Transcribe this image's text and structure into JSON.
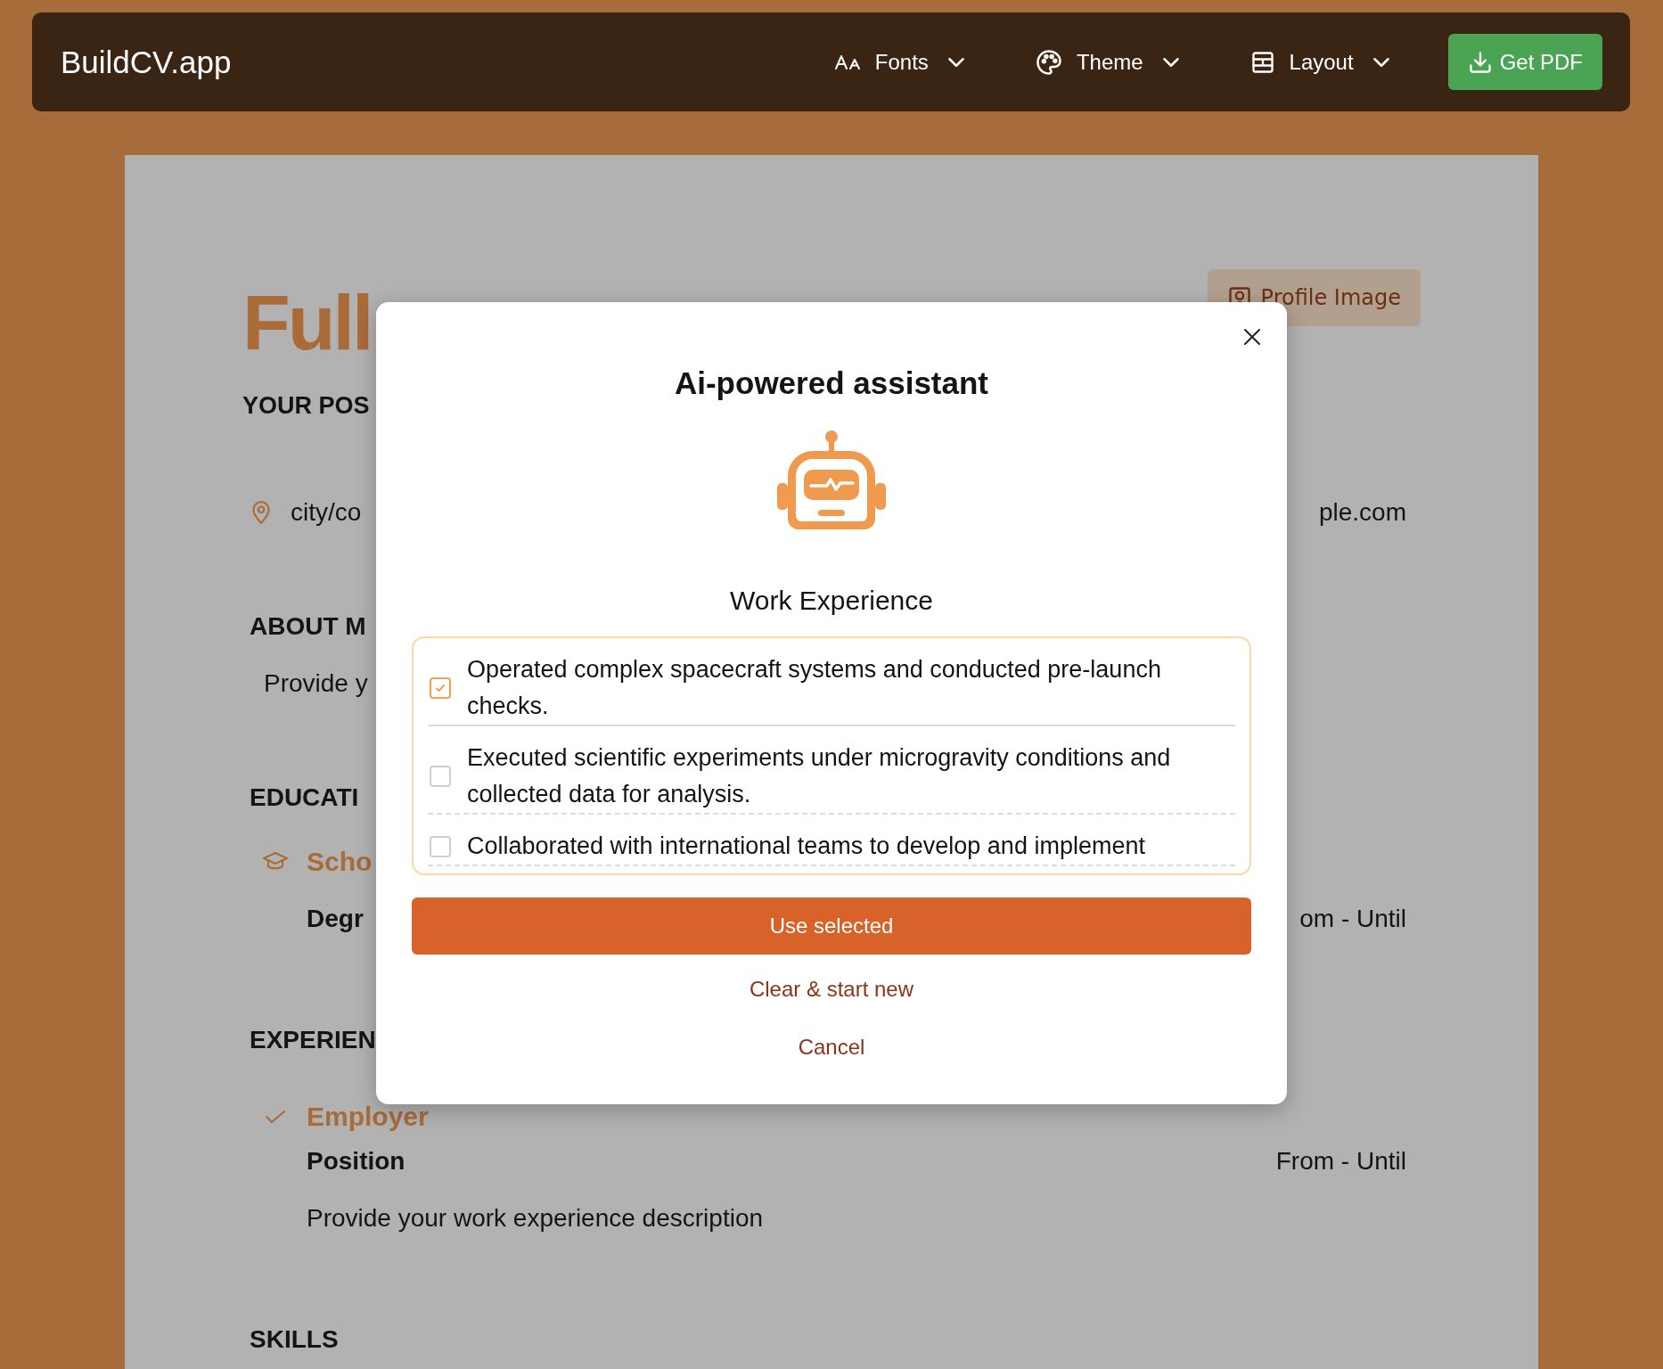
{
  "app": {
    "title": "BuildCV.app"
  },
  "toolbar": {
    "menus": [
      {
        "kind": "fonts",
        "label": "Fonts"
      },
      {
        "kind": "theme",
        "label": "Theme"
      },
      {
        "kind": "layout",
        "label": "Layout"
      }
    ],
    "download_button": {
      "label": "Get PDF"
    }
  },
  "resume": {
    "name": "Full",
    "position": "YOUR POS",
    "profile_image_button": "Profile Image",
    "location": "city/co",
    "email": "ple.com",
    "about": {
      "heading": "ABOUT M",
      "text": "Provide y"
    },
    "education": {
      "heading": "EDUCATI",
      "school": "Scho",
      "degree": "Degr",
      "dates": "om - Until"
    },
    "experience": {
      "heading": "EXPERIEN",
      "employer": "Employer",
      "position": "Position",
      "dates": "From - Until",
      "description": "Provide your work experience description"
    },
    "skills": {
      "heading": "SKILLS"
    }
  },
  "dialog": {
    "title": "Ai-powered assistant",
    "section": "Work Experience",
    "suggestions": [
      {
        "text": "Operated complex spacecraft systems and conducted pre-launch checks.",
        "checked": true
      },
      {
        "text": "Executed scientific experiments under microgravity conditions and collected data for analysis.",
        "checked": false
      },
      {
        "text": "Collaborated with international teams to develop and implement",
        "checked": false
      }
    ],
    "primary_button": "Use selected",
    "secondary_link": "Clear & start new",
    "cancel_link": "Cancel"
  }
}
